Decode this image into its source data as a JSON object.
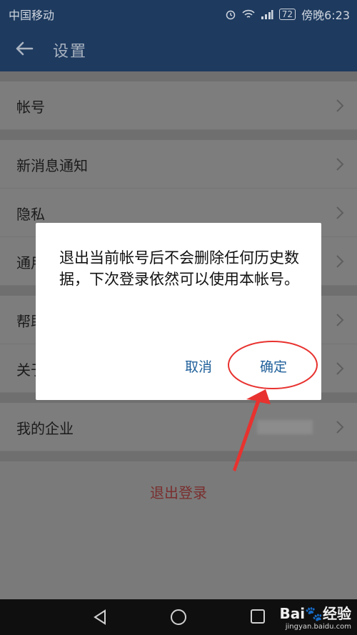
{
  "status_bar": {
    "carrier": "中国移动",
    "battery": "72",
    "time": "傍晚6:23"
  },
  "header": {
    "title": "设置"
  },
  "settings": {
    "items": [
      {
        "label": "帐号"
      },
      {
        "label": "新消息通知"
      },
      {
        "label": "隐私"
      },
      {
        "label": "通用"
      },
      {
        "label": "帮助"
      },
      {
        "label": "关于"
      },
      {
        "label": "我的企业"
      }
    ],
    "logout": "退出登录"
  },
  "dialog": {
    "message": "退出当前帐号后不会删除任何历史数据，下次登录依然可以使用本帐号。",
    "cancel": "取消",
    "confirm": "确定"
  },
  "watermark": {
    "brand": "Bai",
    "brand_tail": "经验",
    "url": "jingyan.baidu.com"
  },
  "colors": {
    "header": "#1e3a5f",
    "dialog_button": "#1f5f9a",
    "logout": "#7a2f2f",
    "annotation": "#e8322f"
  }
}
